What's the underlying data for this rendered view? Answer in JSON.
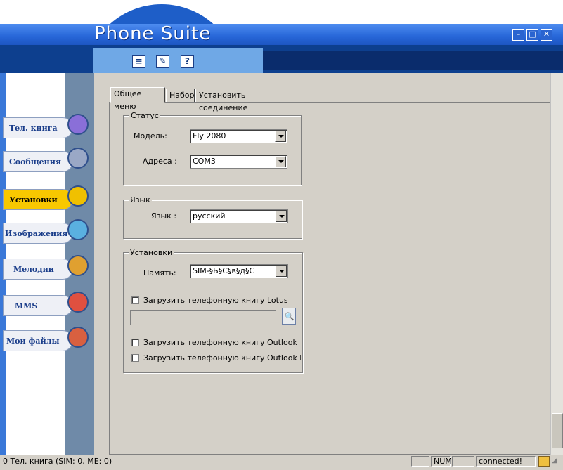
{
  "window": {
    "title": "Phone Suite",
    "controls": [
      "minimize",
      "maximize",
      "close"
    ]
  },
  "toolbar": {
    "icons": [
      "page-icon",
      "edit-icon",
      "help-icon"
    ],
    "help_glyph": "?"
  },
  "sidebar": {
    "items": [
      {
        "label": "Тел. книга",
        "icon": "phone-icon",
        "active": false
      },
      {
        "label": "Сообщения",
        "icon": "envelope-icon",
        "active": false
      },
      {
        "label": "Установки",
        "icon": "tools-icon",
        "active": true
      },
      {
        "label": "Изображения",
        "icon": "picture-icon",
        "active": false
      },
      {
        "label": "Мелодии",
        "icon": "saxophone-icon",
        "active": false
      },
      {
        "label": "MMS",
        "icon": "balloon-icon",
        "active": false
      },
      {
        "label": "Мои файлы",
        "icon": "folder-icon",
        "active": false
      }
    ]
  },
  "tabs": [
    {
      "label": "Общее меню",
      "selected": true
    },
    {
      "label": "Набор",
      "selected": false
    },
    {
      "label": "Установить соединение",
      "selected": false
    }
  ],
  "status_group": {
    "title": "Статус",
    "model_label": "Модель:",
    "model_value": "Fly 2080",
    "address_label": "Адреса :",
    "address_value": "COM3"
  },
  "language_group": {
    "title": "Язык",
    "language_label": "Язык :",
    "language_value": "русский"
  },
  "settings_group": {
    "title": "Установки",
    "memory_label": "Память:",
    "memory_value": "SIM-§Ь§С§в§д§С",
    "checkboxes": [
      {
        "label": "Загрузить телефонную книгу Lotus Notes",
        "checked": false
      },
      {
        "label": "Загрузить телефонную книгу Outlook",
        "checked": false
      },
      {
        "label": "Загрузить телефонную книгу Outlook Express",
        "checked": false
      }
    ],
    "path_value": ""
  },
  "statusbar": {
    "left_text": "0 Тел. книга (SIM: 0, ME: 0)",
    "num": "NUM",
    "connection": "connected!"
  }
}
